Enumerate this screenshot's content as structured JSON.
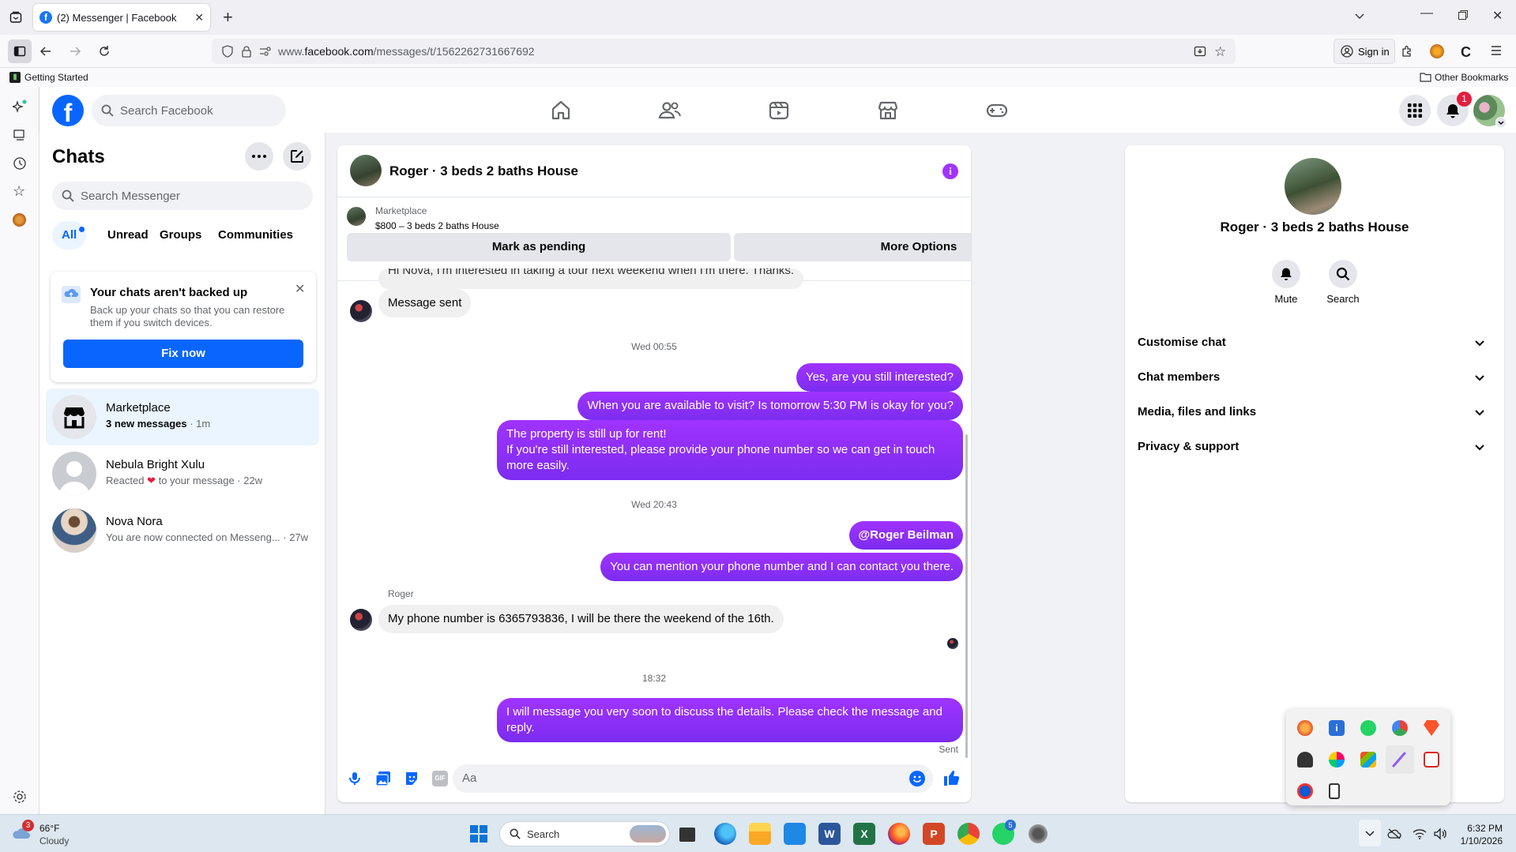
{
  "browser": {
    "tab_title": "(2) Messenger | Facebook",
    "url_prefix": "www.",
    "url_domain": "facebook.com",
    "url_path": "/messages/t/1562262731667692",
    "sign_in": "Sign in",
    "bookmark_getting_started": "Getting Started",
    "bookmark_other": "Other Bookmarks"
  },
  "fb": {
    "search_placeholder": "Search Facebook",
    "notif_count": "1"
  },
  "chats": {
    "title": "Chats",
    "search_placeholder": "Search Messenger",
    "filters": [
      "All",
      "Unread",
      "Groups",
      "Communities"
    ],
    "backup_title": "Your chats aren't backed up",
    "backup_desc": "Back up your chats so that you can restore them if you switch devices.",
    "fix_now": "Fix now",
    "items": [
      {
        "name": "Marketplace",
        "sub": "3 new messages",
        "time": " · 1m"
      },
      {
        "name": "Nebula Bright Xulu",
        "sub_a": "Reacted",
        "sub_b": "to your message",
        "time": " · 22w"
      },
      {
        "name": "Nova Nora",
        "sub": "You are now connected on Messeng...",
        "time": " · 27w"
      }
    ]
  },
  "conversation": {
    "title": "Roger · 3 beds 2 baths House",
    "marketplace_label": "Marketplace",
    "listing": "$800 – 3 beds 2 baths House",
    "mark_pending": "Mark as pending",
    "more_options": "More Options",
    "cut_message": "Hi Nova, I'm interested in taking a tour next weekend when I'm there. Thanks.",
    "msg_sent": "Message sent",
    "ts1": "Wed 00:55",
    "out1": "Yes, are you still interested?",
    "out2": "When you are available to visit? Is tomorrow 5:30 PM is okay for you?",
    "out3_line1": "The property is still up for rent!",
    "out3_line2": "If you're still interested, please provide your phone number so we can get in touch more easily.",
    "ts2": "Wed 20:43",
    "out4": "@Roger Beilman",
    "out5": "You can mention your phone number and I can contact you there.",
    "sender": "Roger",
    "in2": "My phone number is 6365793836, I will be there the weekend of the 16th.",
    "ts3": "18:32",
    "out6": "I will message you very soon to discuss the details. Please check the message and reply.",
    "status": "Sent",
    "composer_placeholder": "Aa"
  },
  "details": {
    "title": "Roger · 3 beds 2 baths House",
    "mute": "Mute",
    "search": "Search",
    "rows": [
      "Customise chat",
      "Chat members",
      "Media, files and links",
      "Privacy & support"
    ]
  },
  "taskbar": {
    "weather_temp": "66°F",
    "weather_desc": "Cloudy",
    "weather_badge": "3",
    "search": "Search",
    "time": "6:32 PM",
    "date": "1/10/2026",
    "whatsapp_badge": "5"
  }
}
